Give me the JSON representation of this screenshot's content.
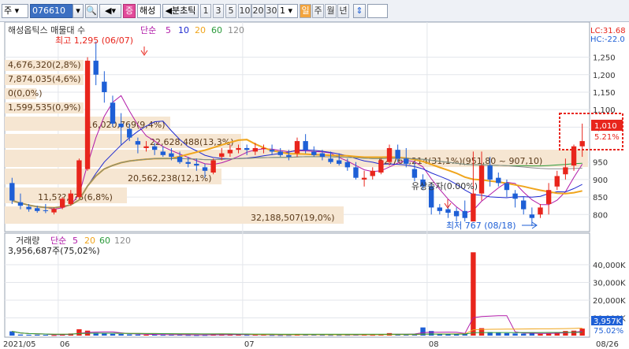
{
  "toolbar": {
    "market": "주",
    "code": "076610",
    "name_badge": "증",
    "name": "해성",
    "period_label": "분초틱",
    "intervals": [
      "1",
      "3",
      "5",
      "10",
      "20",
      "30"
    ],
    "count": "1",
    "period_tabs": [
      "일",
      "주",
      "월",
      "년"
    ]
  },
  "price_panel": {
    "legend_title": "해성옵틱스 매물대 수",
    "legend_ma_label": "단순",
    "legend_ma_periods": [
      "5",
      "10",
      "20",
      "60",
      "120"
    ],
    "lc_label": "LC:31.68",
    "hc_label": "HC:-22.0",
    "high_annotation": "최고 1,295 (06/07)",
    "low_annotation": "최저 767 (08/18)",
    "rights_issue_label": "유상증자(0.00%)",
    "current_price": "1,010",
    "current_change": "5.21%",
    "y_ticks": [
      "1,250",
      "1,200",
      "1,150",
      "1,100",
      "1,050",
      "950",
      "900",
      "850",
      "800"
    ],
    "volume_profile": [
      {
        "label": "4,676,320(2,8%)"
      },
      {
        "label": "7,874,035(4,6%)"
      },
      {
        "label": "0(0,0%)"
      },
      {
        "label": "1,599,535(0,9%)"
      },
      {
        "label": "16,020,769(9,4%)"
      },
      {
        "label": "22,628,488(13,3%)"
      },
      {
        "label": "52,764,214(31,1%)(951,80 ~ 907,10)"
      },
      {
        "label": "20,562,238(12,1%)"
      },
      {
        "label": "11,5??,??5(6,8%)"
      },
      {
        "label": "32,188,507(19,0%)"
      }
    ]
  },
  "volume_panel": {
    "legend_title": "거래량",
    "legend_ma_label": "단순",
    "legend_ma_periods": [
      "5",
      "20",
      "60",
      "120"
    ],
    "info_line": "3,956,687주(75,02%)",
    "current_volume": "3,957K",
    "current_percent": "75.02%",
    "y_ticks": [
      "40,000K",
      "30,000K",
      "20,000K",
      "10,000K"
    ]
  },
  "x_axis": {
    "labels": [
      "2021/05",
      "06",
      "07",
      "08",
      "08/26"
    ]
  },
  "colors": {
    "up": "#e8251c",
    "down": "#1e5fd6",
    "ma5": "#b11aa8",
    "ma10": "#1f2bd0",
    "ma20": "#f0a51c",
    "ma60": "#2a9a3a",
    "ma120": "#8c8c8c",
    "profile": "#f6e6d2",
    "highlight_box": "#e8251c"
  },
  "chart_data": {
    "type": "candlestick",
    "title": "해성옵틱스",
    "ylabel": "",
    "ylim": [
      760,
      1310
    ],
    "volume_ylim": [
      0,
      48000
    ],
    "dates": [
      "05/24",
      "05/25",
      "05/26",
      "05/27",
      "05/28",
      "05/31",
      "06/01",
      "06/02",
      "06/03",
      "06/04",
      "06/07",
      "06/08",
      "06/09",
      "06/10",
      "06/11",
      "06/14",
      "06/15",
      "06/16",
      "06/17",
      "06/18",
      "06/21",
      "06/22",
      "06/23",
      "06/24",
      "06/25",
      "06/28",
      "06/29",
      "06/30",
      "07/01",
      "07/02",
      "07/05",
      "07/06",
      "07/07",
      "07/08",
      "07/09",
      "07/12",
      "07/13",
      "07/14",
      "07/15",
      "07/16",
      "07/19",
      "07/20",
      "07/21",
      "07/22",
      "07/23",
      "07/26",
      "07/27",
      "07/28",
      "07/29",
      "07/30",
      "08/02",
      "08/03",
      "08/04",
      "08/05",
      "08/06",
      "08/09",
      "08/10",
      "08/11",
      "08/12",
      "08/13",
      "08/16",
      "08/17",
      "08/18",
      "08/19",
      "08/20",
      "08/23",
      "08/24",
      "08/25",
      "08/26"
    ],
    "open": [
      890,
      835,
      822,
      818,
      812,
      806,
      820,
      830,
      850,
      930,
      1240,
      1180,
      1120,
      1060,
      1045,
      1010,
      990,
      995,
      980,
      975,
      965,
      950,
      945,
      935,
      920,
      965,
      975,
      985,
      990,
      980,
      990,
      985,
      980,
      970,
      975,
      1010,
      980,
      975,
      960,
      955,
      950,
      935,
      900,
      910,
      920,
      950,
      985,
      960,
      930,
      900,
      880,
      820,
      815,
      810,
      810,
      780,
      860,
      940,
      905,
      890,
      860,
      840,
      800,
      800,
      830,
      880,
      915,
      940,
      995
    ],
    "high": [
      905,
      860,
      830,
      825,
      830,
      820,
      850,
      870,
      960,
      1250,
      1295,
      1210,
      1140,
      1090,
      1060,
      1020,
      1010,
      1005,
      995,
      990,
      980,
      965,
      960,
      945,
      960,
      990,
      1000,
      1000,
      1000,
      1005,
      1000,
      1000,
      990,
      985,
      1020,
      1030,
      995,
      985,
      980,
      975,
      960,
      950,
      925,
      935,
      960,
      1000,
      1000,
      990,
      950,
      915,
      890,
      830,
      825,
      820,
      840,
      980,
      980,
      965,
      920,
      900,
      870,
      850,
      820,
      830,
      890,
      925,
      960,
      1000,
      1060
    ],
    "low": [
      830,
      815,
      808,
      805,
      804,
      800,
      815,
      825,
      845,
      925,
      1170,
      1120,
      1050,
      1000,
      1010,
      975,
      980,
      970,
      965,
      955,
      945,
      935,
      925,
      905,
      915,
      955,
      965,
      975,
      970,
      970,
      975,
      970,
      965,
      955,
      965,
      975,
      965,
      955,
      945,
      940,
      925,
      900,
      880,
      900,
      915,
      940,
      950,
      935,
      895,
      870,
      800,
      800,
      790,
      780,
      780,
      780,
      840,
      880,
      880,
      850,
      820,
      800,
      767,
      790,
      800,
      870,
      900,
      925,
      965
    ],
    "close": [
      840,
      825,
      815,
      810,
      810,
      815,
      845,
      860,
      955,
      1240,
      1200,
      1150,
      1060,
      1050,
      1020,
      1000,
      995,
      985,
      970,
      965,
      950,
      945,
      940,
      925,
      955,
      975,
      985,
      990,
      985,
      990,
      990,
      980,
      970,
      965,
      1010,
      985,
      970,
      965,
      950,
      945,
      935,
      905,
      905,
      925,
      955,
      990,
      960,
      945,
      905,
      880,
      820,
      810,
      805,
      795,
      790,
      860,
      940,
      900,
      890,
      870,
      845,
      815,
      790,
      820,
      870,
      910,
      935,
      995,
      1010
    ],
    "volume": [
      2400,
      600,
      500,
      500,
      450,
      300,
      900,
      1200,
      3600,
      2800,
      1600,
      1400,
      1000,
      900,
      700,
      600,
      500,
      500,
      400,
      450,
      500,
      350,
      300,
      350,
      700,
      600,
      500,
      450,
      400,
      500,
      450,
      350,
      300,
      300,
      900,
      700,
      450,
      400,
      350,
      350,
      400,
      600,
      500,
      400,
      700,
      1400,
      900,
      600,
      900,
      4600,
      2600,
      900,
      700,
      800,
      1100,
      47000,
      4200,
      2000,
      1600,
      1400,
      1200,
      1100,
      1600,
      1000,
      1200,
      1700,
      2600,
      2800,
      3957
    ]
  }
}
